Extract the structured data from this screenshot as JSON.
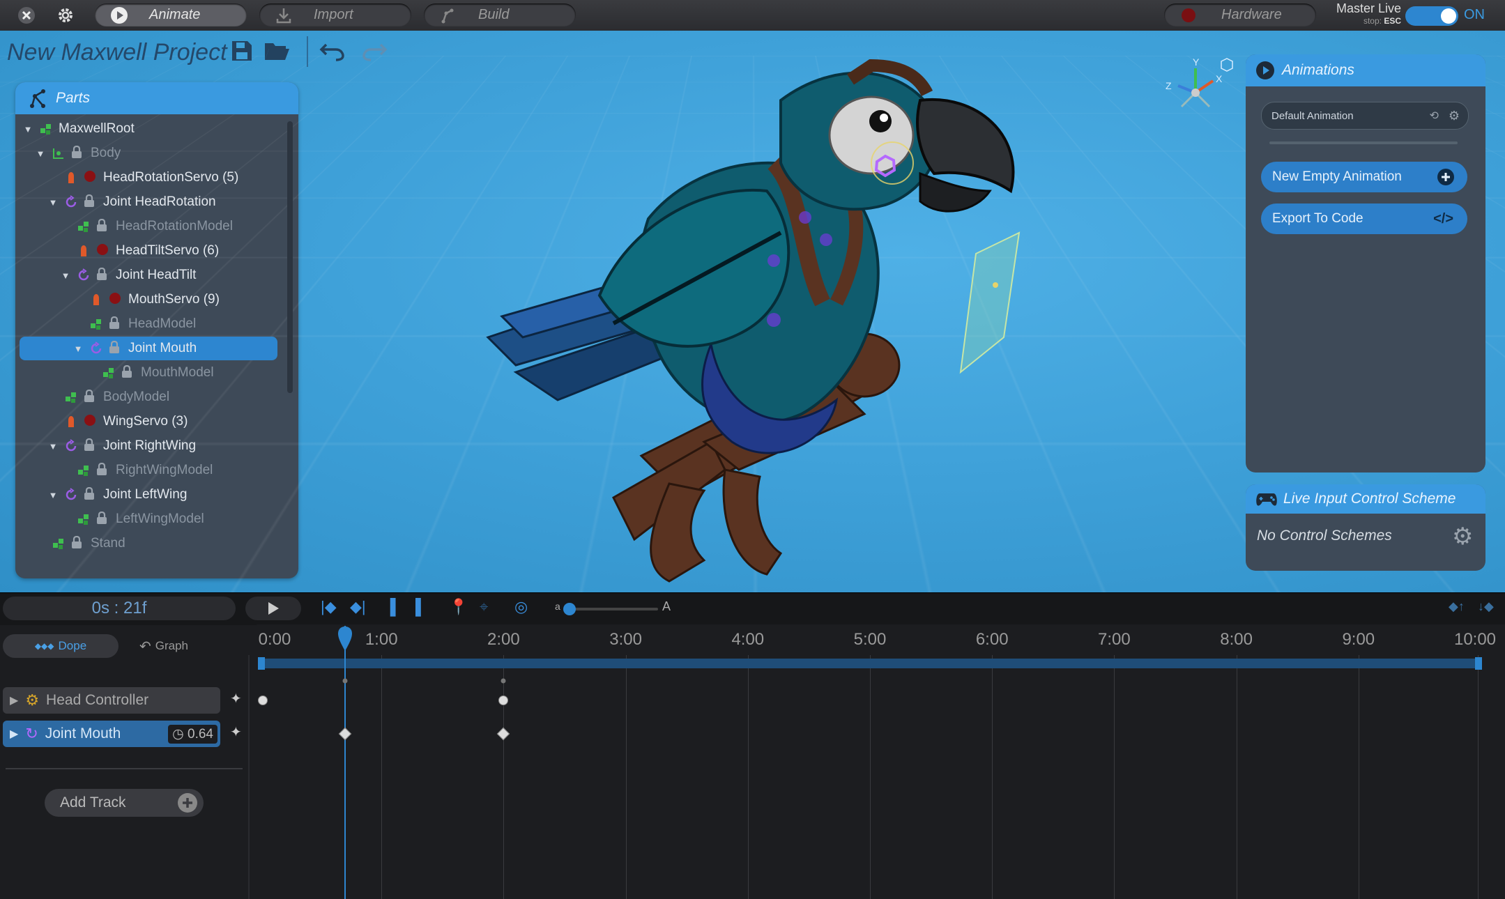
{
  "topbar": {
    "modes": [
      {
        "label": "Animate",
        "active": true,
        "icon": "play-circle-icon"
      },
      {
        "label": "Import",
        "active": false,
        "icon": "download-icon"
      },
      {
        "label": "Build",
        "active": false,
        "icon": "build-icon"
      }
    ],
    "hardware_label": "Hardware",
    "master_live_label": "Master Live",
    "stop_hint_prefix": "stop:",
    "stop_hint_key": "ESC",
    "toggle_state": "ON"
  },
  "project": {
    "title": "New Maxwell Project"
  },
  "parts": {
    "header": "Parts",
    "tree": [
      {
        "label": "MaxwellRoot",
        "indent": 0,
        "caret": "down",
        "icon": "model-icon",
        "locked": false,
        "dim": false
      },
      {
        "label": "Body",
        "indent": 1,
        "caret": "down",
        "icon": "body-icon",
        "locked": true,
        "dim": true
      },
      {
        "label": "HeadRotationServo (5)",
        "indent": 2,
        "caret": "",
        "icon": "servo-icon",
        "locked": true,
        "dim": false
      },
      {
        "label": "Joint HeadRotation",
        "indent": 2,
        "caret": "down",
        "icon": "joint-icon",
        "locked": true,
        "dim": false
      },
      {
        "label": "HeadRotationModel",
        "indent": 3,
        "caret": "",
        "icon": "model-icon",
        "locked": true,
        "dim": true
      },
      {
        "label": "HeadTiltServo (6)",
        "indent": 3,
        "caret": "",
        "icon": "servo-icon",
        "locked": true,
        "dim": false
      },
      {
        "label": "Joint HeadTilt",
        "indent": 3,
        "caret": "down",
        "icon": "joint-icon",
        "locked": true,
        "dim": false
      },
      {
        "label": "MouthServo (9)",
        "indent": 4,
        "caret": "",
        "icon": "servo-icon",
        "locked": true,
        "dim": false
      },
      {
        "label": "HeadModel",
        "indent": 4,
        "caret": "",
        "icon": "model-icon",
        "locked": true,
        "dim": true
      },
      {
        "label": "Joint Mouth",
        "indent": 4,
        "caret": "down",
        "icon": "joint-icon",
        "locked": true,
        "dim": false,
        "selected": true
      },
      {
        "label": "MouthModel",
        "indent": 5,
        "caret": "",
        "icon": "model-icon",
        "locked": true,
        "dim": true
      },
      {
        "label": "BodyModel",
        "indent": 2,
        "caret": "",
        "icon": "model-icon",
        "locked": true,
        "dim": true
      },
      {
        "label": "WingServo (3)",
        "indent": 2,
        "caret": "",
        "icon": "servo-icon",
        "locked": true,
        "dim": false
      },
      {
        "label": "Joint RightWing",
        "indent": 2,
        "caret": "down",
        "icon": "joint-icon",
        "locked": true,
        "dim": false
      },
      {
        "label": "RightWingModel",
        "indent": 3,
        "caret": "",
        "icon": "model-icon",
        "locked": true,
        "dim": true
      },
      {
        "label": "Joint LeftWing",
        "indent": 2,
        "caret": "down",
        "icon": "joint-icon",
        "locked": true,
        "dim": false
      },
      {
        "label": "LeftWingModel",
        "indent": 3,
        "caret": "",
        "icon": "model-icon",
        "locked": true,
        "dim": true
      },
      {
        "label": "Stand",
        "indent": 1,
        "caret": "",
        "icon": "model-icon",
        "locked": true,
        "dim": true
      }
    ]
  },
  "gizmo": {
    "axis_y": "Y",
    "axis_x": "X",
    "axis_z": "Z"
  },
  "animations": {
    "header": "Animations",
    "selected": "Default Animation",
    "new_label": "New Empty Animation",
    "export_label": "Export To Code"
  },
  "live_input": {
    "header": "Live Input Control Scheme",
    "empty_label": "No Control Schemes"
  },
  "timeline": {
    "current_time": "0s : 21f",
    "zoom_min_label": "a",
    "zoom_max_label": "A",
    "views": [
      {
        "label": "Dope",
        "active": true
      },
      {
        "label": "Graph",
        "active": false
      }
    ],
    "ticks": [
      "0:00",
      "1:00",
      "2:00",
      "3:00",
      "4:00",
      "5:00",
      "6:00",
      "7:00",
      "8:00",
      "9:00",
      "10:00"
    ],
    "tracks": [
      {
        "label": "Head Controller",
        "icon": "controller-icon",
        "value": ""
      },
      {
        "label": "Joint Mouth",
        "icon": "joint-icon",
        "value": "0.64"
      }
    ],
    "add_track_label": "Add Track",
    "playhead_seconds": 0.7
  },
  "colors": {
    "accent": "#3a9ae0",
    "viewport_bg": "#3fa1d9",
    "panel_bg": "#3e4a58",
    "servo": "#e0592a",
    "joint": "#9b5de5",
    "model": "#3fbf4f"
  }
}
